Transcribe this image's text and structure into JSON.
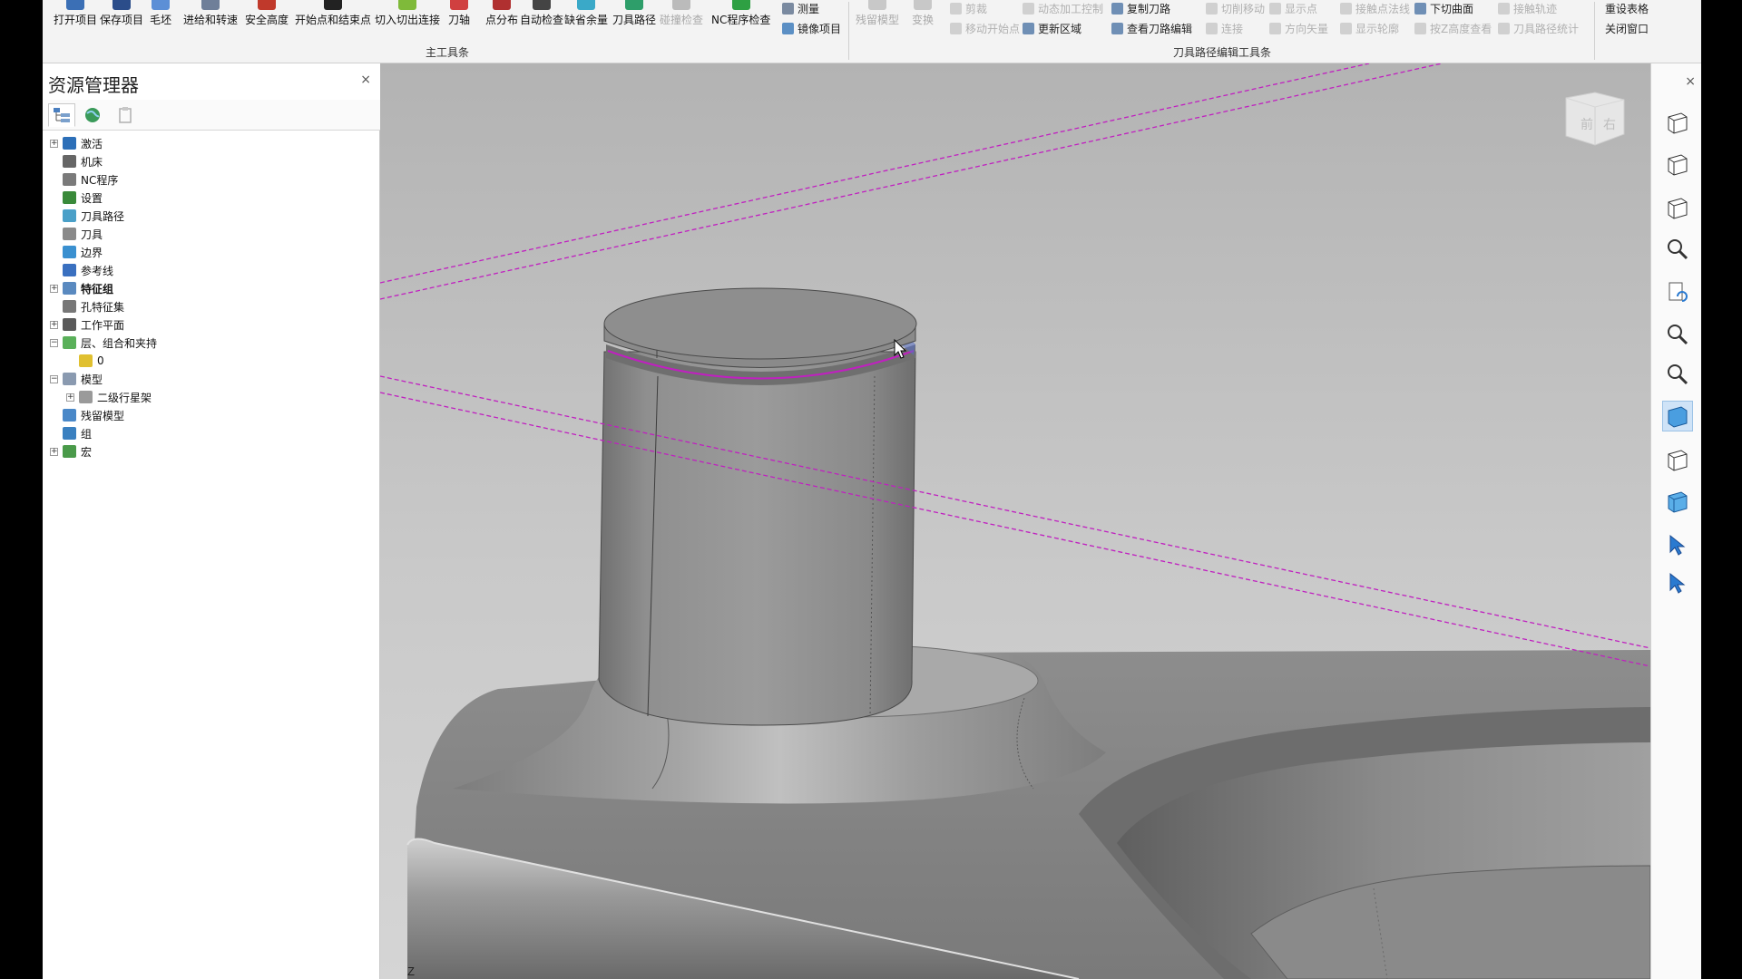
{
  "ribbon": {
    "main_group_label": "主工具条",
    "edit_group_label": "刀具路径编辑工具条",
    "main_buttons": [
      {
        "label": "打开项目",
        "icon": "open-project-icon",
        "color": "#3b6fb5"
      },
      {
        "label": "保存项目",
        "icon": "save-project-icon",
        "color": "#2b4d8a"
      },
      {
        "label": "毛坯",
        "icon": "stock-icon",
        "color": "#5c8fd6"
      },
      {
        "label": "进给和转速",
        "icon": "feeds-speeds-icon",
        "color": "#6f7f99"
      },
      {
        "label": "安全高度",
        "icon": "rapid-height-icon",
        "color": "#c0392b"
      },
      {
        "label": "开始点和结束点",
        "icon": "start-end-point-icon",
        "color": "#222222"
      },
      {
        "label": "切入切出连接",
        "icon": "leads-links-icon",
        "color": "#7fba3a"
      },
      {
        "label": "刀轴",
        "icon": "tool-axis-icon",
        "color": "#d04040"
      },
      {
        "label": "点分布",
        "icon": "point-distribution-icon",
        "color": "#b03030"
      },
      {
        "label": "自动检查",
        "icon": "auto-verify-icon",
        "color": "#444444"
      },
      {
        "label": "缺省余量",
        "icon": "default-thickness-icon",
        "color": "#3aa9c8"
      },
      {
        "label": "刀具路径",
        "icon": "toolpath-icon",
        "color": "#2e9e6a"
      },
      {
        "label": "碰撞检查",
        "icon": "collision-check-icon",
        "color": "#bbbbbb",
        "disabled": true
      },
      {
        "label": "NC程序检查",
        "icon": "nc-check-icon",
        "color": "#2ea043"
      }
    ],
    "main_small": [
      {
        "label": "测量",
        "icon": "measure-icon"
      },
      {
        "label": "镜像项目",
        "icon": "mirror-project-icon"
      }
    ],
    "edit_big": [
      {
        "label": "残留模型",
        "icon": "rest-model-icon",
        "disabled": true
      },
      {
        "label": "变换",
        "icon": "transform-icon",
        "disabled": true
      }
    ],
    "edit_small": [
      {
        "label": "剪裁",
        "disabled": true
      },
      {
        "label": "移动开始点",
        "disabled": true
      },
      {
        "label": "动态加工控制",
        "disabled": true
      },
      {
        "label": "更新区域",
        "disabled": false
      },
      {
        "label": "复制刀路",
        "disabled": false
      },
      {
        "label": "查看刀路编辑",
        "disabled": false
      },
      {
        "label": "切削移动",
        "disabled": true
      },
      {
        "label": "连接",
        "disabled": true
      },
      {
        "label": "显示点",
        "disabled": true
      },
      {
        "label": "方向矢量",
        "disabled": true
      },
      {
        "label": "接触点法线",
        "disabled": true
      },
      {
        "label": "显示轮廓",
        "disabled": true
      },
      {
        "label": "下切曲面",
        "disabled": false
      },
      {
        "label": "按Z高度查看",
        "disabled": true
      },
      {
        "label": "接触轨迹",
        "disabled": true
      },
      {
        "label": "刀具路径统计",
        "disabled": true
      }
    ],
    "far_right": [
      {
        "label": "重设表格"
      },
      {
        "label": "关闭窗口"
      }
    ]
  },
  "explorer": {
    "title": "资源管理器",
    "close": "×",
    "tabs": [
      "tree-view-icon",
      "globe-icon",
      "clipboard-icon"
    ],
    "items": [
      {
        "label": "激活",
        "icon": "activate-icon",
        "expander": "+",
        "bold": false,
        "level": 0
      },
      {
        "label": "机床",
        "icon": "machine-icon",
        "expander": "",
        "bold": false,
        "level": 0
      },
      {
        "label": "NC程序",
        "icon": "nc-program-icon",
        "expander": "",
        "bold": false,
        "level": 0
      },
      {
        "label": "设置",
        "icon": "setup-icon",
        "expander": "",
        "bold": false,
        "level": 0
      },
      {
        "label": "刀具路径",
        "icon": "toolpath-icon",
        "expander": "",
        "bold": false,
        "level": 0
      },
      {
        "label": "刀具",
        "icon": "tool-icon",
        "expander": "",
        "bold": false,
        "level": 0
      },
      {
        "label": "边界",
        "icon": "boundary-icon",
        "expander": "",
        "bold": false,
        "level": 0
      },
      {
        "label": "参考线",
        "icon": "pattern-icon",
        "expander": "",
        "bold": false,
        "level": 0
      },
      {
        "label": "特征组",
        "icon": "feature-group-icon",
        "expander": "+",
        "bold": true,
        "level": 0
      },
      {
        "label": "孔特征集",
        "icon": "hole-feature-icon",
        "expander": "",
        "bold": false,
        "level": 0
      },
      {
        "label": "工作平面",
        "icon": "workplane-icon",
        "expander": "+",
        "bold": false,
        "level": 0
      },
      {
        "label": "层、组合和夹持",
        "icon": "levels-icon",
        "expander": "−",
        "bold": false,
        "level": 0
      },
      {
        "label": "0",
        "icon": "level-zero-icon",
        "expander": "",
        "bold": false,
        "level": 1
      },
      {
        "label": "模型",
        "icon": "model-icon",
        "expander": "−",
        "bold": false,
        "level": 0
      },
      {
        "label": "二级行星架",
        "icon": "model-item-icon",
        "expander": "+",
        "bold": false,
        "level": 1
      },
      {
        "label": "残留模型",
        "icon": "stock-model-icon",
        "expander": "",
        "bold": false,
        "level": 0
      },
      {
        "label": "组",
        "icon": "group-folder-icon",
        "expander": "",
        "bold": false,
        "level": 0
      },
      {
        "label": "宏",
        "icon": "macro-icon",
        "expander": "+",
        "bold": false,
        "level": 0
      }
    ]
  },
  "viewport": {
    "view_cube_front": "前",
    "view_cube_right": "右",
    "axis_label": "Z",
    "background_top": "#b5b5b5",
    "background_bottom": "#d8d8d8",
    "toolpath_color": "#c020c0"
  },
  "right_toolbar": {
    "close": "×",
    "buttons": [
      "view-iso-icon",
      "view-top-box-icon",
      "view-cube-icon",
      "zoom-refresh-icon",
      "page-refresh-icon",
      "zoom-box-icon",
      "zoom-fit-icon",
      "shaded-icon",
      "wireframe-icon",
      "shaded-solid-icon",
      "select-icon",
      "select-undo-icon"
    ]
  }
}
